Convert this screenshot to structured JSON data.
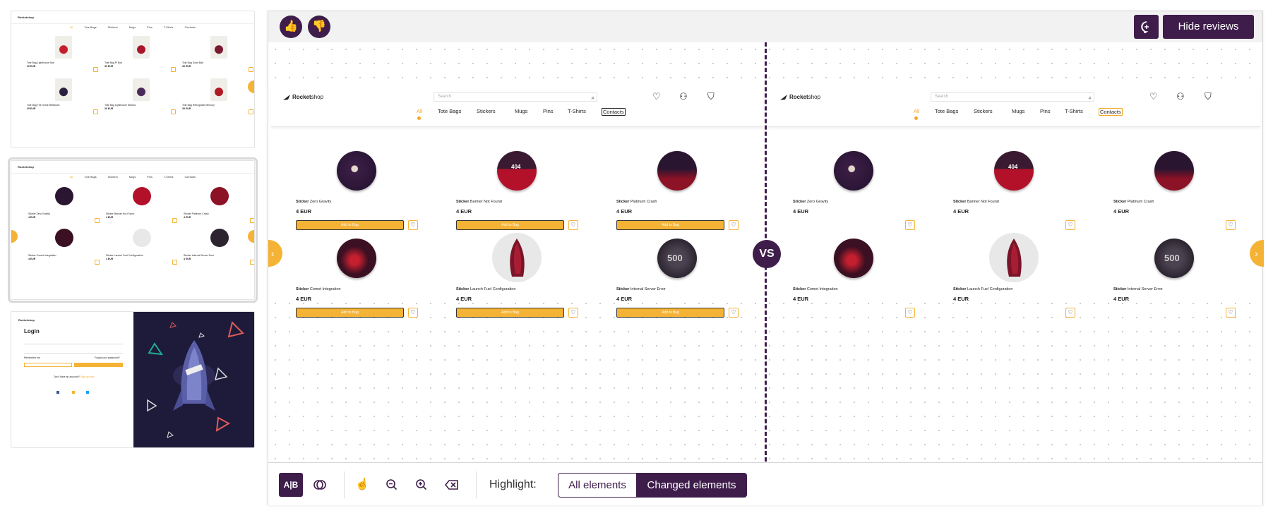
{
  "thumbnails": {
    "shop_logo": "Rocketshop",
    "nav": [
      "All",
      "Tote Bags",
      "Stickers",
      "Mugs",
      "Pins",
      "T-Shirts",
      "Contacts"
    ],
    "tote_titles": [
      "Tote Bag Lighthouse Noir",
      "Tote Bag Pi Eye",
      "Tote Bag Solar Ball",
      "Tote Bag The Great Meltdown",
      "Tote Bag Lighthouse Nebula",
      "Tote Bag Retrograde Mercury"
    ],
    "tote_price": "39 EUR",
    "sticker_titles": [
      "Sticker Zero Gravity",
      "Sticker Banner Not Found",
      "Sticker Platinum Crash",
      "Sticker Comet Integration",
      "Sticker Launch Fuel Configuration",
      "Sticker Internal Server Error"
    ],
    "sticker_price": "4 EUR",
    "login_title": "Login",
    "login_forgot": "Forgot your password?",
    "login_remember": "Remember me",
    "login_no_account": "Don't have an account?",
    "login_sign_up": "Sign up now"
  },
  "toolbar": {
    "thumbs_up": "👍",
    "thumbs_down": "👎",
    "hide_reviews": "Hide reviews"
  },
  "shop": {
    "logo_bold": "Rocket",
    "logo_rest": "shop",
    "search_placeholder": "Search",
    "nav": [
      "All",
      "Tote Bags",
      "Stickers",
      "Mugs",
      "Pins",
      "T-Shirts",
      "Contacts"
    ],
    "add_to_bag": "Add to Bag",
    "products": [
      {
        "type": "Sticker",
        "name": "Zero Gravity",
        "price": "4 EUR",
        "color": "#2a1535"
      },
      {
        "type": "Sticker",
        "name": "Banner Not Found",
        "price": "4 EUR",
        "color": "#b3112a"
      },
      {
        "type": "Sticker",
        "name": "Platinum Crash",
        "price": "4 EUR",
        "color": "#8c1226"
      },
      {
        "type": "Sticker",
        "name": "Comet Integration",
        "price": "4 EUR",
        "color": "#3a1022"
      },
      {
        "type": "Sticker",
        "name": "Launch Fuel Configuration",
        "price": "4 EUR",
        "color": "#e8e8e8"
      },
      {
        "type": "Sticker",
        "name": "Internal Server Error",
        "price": "4 EUR",
        "color": "#2c2530"
      }
    ],
    "badge_404": "404",
    "badge_500": "500"
  },
  "compare": {
    "vs": "VS"
  },
  "bottom": {
    "ab_label": "A|B",
    "highlight_label": "Highlight:",
    "all_elements": "All elements",
    "changed_elements": "Changed elements"
  }
}
